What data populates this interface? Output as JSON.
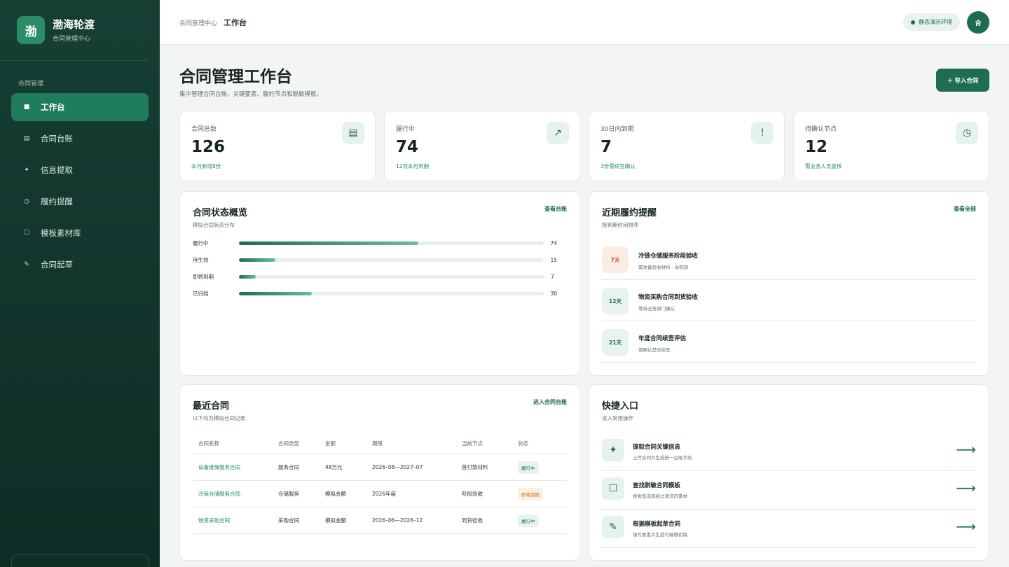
{
  "brand": {
    "logo": "渤",
    "title": "渤海轮渡",
    "subtitle": "合同管理中心"
  },
  "sidebar": {
    "section": "合同管理",
    "items": [
      {
        "label": "工作台",
        "icon": "■"
      },
      {
        "label": "合同台账",
        "icon": "▤"
      },
      {
        "label": "信息提取",
        "icon": "✦"
      },
      {
        "label": "履约提醒",
        "icon": "◷"
      },
      {
        "label": "模板素材库",
        "icon": "☐"
      },
      {
        "label": "合同起草",
        "icon": "✎"
      }
    ]
  },
  "header": {
    "breadcrumb_parent": "合同管理中心",
    "breadcrumb_current": "工作台",
    "env_badge": "静态演示环境",
    "avatar": "合"
  },
  "page": {
    "title": "合同管理工作台",
    "subtitle": "集中管理合同台账、关键要素、履约节点和脱敏模板。",
    "import_button": "＋ 导入合同"
  },
  "stats": [
    {
      "label": "合同总数",
      "value": "126",
      "note": "本月新增8份",
      "icon": "▤"
    },
    {
      "label": "履行中",
      "value": "74",
      "note": "12项本月到期",
      "icon": "↗"
    },
    {
      "label": "30日内到期",
      "value": "7",
      "note": "3份需续签确认",
      "icon": "!"
    },
    {
      "label": "待确认节点",
      "value": "12",
      "note": "需业务人员复核",
      "icon": "◷"
    }
  ],
  "status_overview": {
    "title": "合同状态概览",
    "subtitle": "模拟合同状态分布",
    "link": "查看台账",
    "max": 126,
    "bars": [
      {
        "label": "履行中",
        "value": 74
      },
      {
        "label": "待生效",
        "value": 15
      },
      {
        "label": "即将到期",
        "value": 7
      },
      {
        "label": "已归档",
        "value": 30
      }
    ]
  },
  "reminders": {
    "title": "近期履约提醒",
    "subtitle": "按到期时间排序",
    "link": "查看全部",
    "items": [
      {
        "days": "7天",
        "title": "冷链仓储服务阶段验收",
        "sub": "需准备验收材料 · 采购部",
        "warn": true
      },
      {
        "days": "12天",
        "title": "物资采购合同到货验收",
        "sub": "等待业务部门确认",
        "warn": false
      },
      {
        "days": "21天",
        "title": "年度合同续签评估",
        "sub": "需确认是否续签",
        "warn": false
      }
    ]
  },
  "recent": {
    "title": "最近合同",
    "subtitle": "以下均为模拟合同记录",
    "link": "进入合同台账",
    "columns": [
      "合同名称",
      "合同类型",
      "金额",
      "期限",
      "当前节点",
      "状态"
    ],
    "rows": [
      {
        "name": "设备维保服务合同",
        "type": "服务合同",
        "amount": "48万元",
        "term": "2026–08—2027–07",
        "node": "首付款材料",
        "status": "履行中",
        "warn": false
      },
      {
        "name": "冷链仓储服务合同",
        "type": "仓储服务",
        "amount": "模拟金额",
        "term": "2026年度",
        "node": "阶段验收",
        "status": "即将到期",
        "warn": true
      },
      {
        "name": "物资采购合同",
        "type": "采购合同",
        "amount": "模拟金额",
        "term": "2026–06—2026–12",
        "node": "到货验收",
        "status": "履行中",
        "warn": false
      }
    ]
  },
  "quick": {
    "title": "快捷入口",
    "subtitle": "进入常用操作",
    "items": [
      {
        "icon": "✦",
        "title": "提取合同关键信息",
        "sub": "上传合同并生成统一台账字段",
        "arrow": "⟶"
      },
      {
        "icon": "☐",
        "title": "查找脱敏合同模板",
        "sub": "按类型选择经过清洗的素材",
        "arrow": "⟶"
      },
      {
        "icon": "✎",
        "title": "根据模板起草合同",
        "sub": "填写要素并生成可编辑初稿",
        "arrow": "⟶"
      }
    ]
  },
  "colors": {
    "accent": "#1f6d50",
    "sidebar": "#163f34",
    "warn": "#c1562c"
  }
}
